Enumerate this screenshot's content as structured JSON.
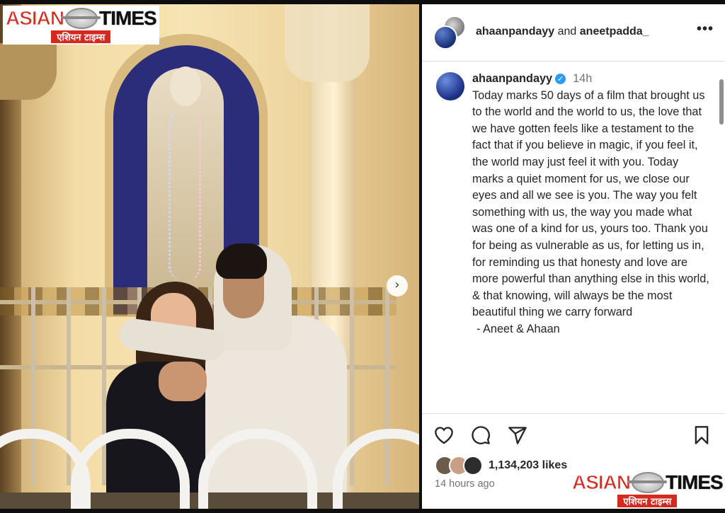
{
  "watermark": {
    "brand_left": "ASIAN",
    "brand_right": "TIMES",
    "hindi": "एशियन टाइम्स",
    "brand_color": "#d5281f"
  },
  "photo": {
    "next_icon": "chevron-right-icon"
  },
  "post": {
    "header": {
      "user1": "ahaanpandayy",
      "joiner": "and",
      "user2": "aneetpadda_",
      "more_icon": "more-horizontal-icon"
    },
    "caption": {
      "username": "ahaanpandayy",
      "verified_icon": "verified-badge-icon",
      "time": "14h",
      "text": "Today marks 50 days of a film that brought us to the world and the world to us, the love that we have gotten feels like a testament to the fact that if you believe in magic, if you feel it, the world may just feel it with you. Today marks a quiet moment for us, we close our eyes and all we see is you. The way you felt something with us, the way you made what was one of a kind for us, yours too. Thank you for being as vulnerable as us, for letting us in, for reminding us that honesty and love are more powerful than anything else in this world, & that knowing, will always be the most beautiful thing we carry forward",
      "signature": "- Aneet & Ahaan"
    },
    "actions": {
      "like_icon": "heart-icon",
      "comment_icon": "comment-icon",
      "share_icon": "send-icon",
      "save_icon": "bookmark-icon"
    },
    "likes": "1,134,203 likes",
    "timestamp": "14 hours ago",
    "verified_color": "#2f9bf0"
  }
}
